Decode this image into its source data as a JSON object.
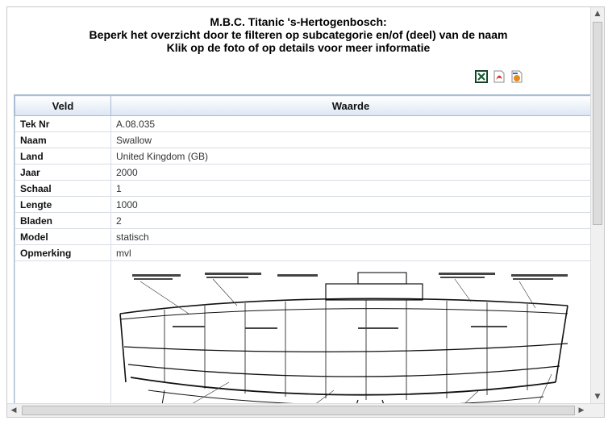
{
  "header": {
    "line1": "M.B.C. Titanic 's-Hertogenbosch:",
    "line2": "Beperk het overzicht door te filteren op subcategorie en/of (deel) van de naam",
    "line3": "Klik op de foto of op details voor meer informatie"
  },
  "export": {
    "excel_icon": "excel-icon",
    "pdf_icon": "pdf-icon",
    "xml_icon": "xml-icon"
  },
  "table": {
    "col_field": "Veld",
    "col_value": "Waarde",
    "rows": [
      {
        "field": "Tek Nr",
        "value": "A.08.035"
      },
      {
        "field": "Naam",
        "value": "Swallow"
      },
      {
        "field": "Land",
        "value": "United Kingdom (GB)"
      },
      {
        "field": "Jaar",
        "value": "2000"
      },
      {
        "field": "Schaal",
        "value": "1"
      },
      {
        "field": "Lengte",
        "value": "1000"
      },
      {
        "field": "Bladen",
        "value": "2"
      },
      {
        "field": "Model",
        "value": "statisch"
      },
      {
        "field": "Opmerking",
        "value": "mvl"
      }
    ]
  },
  "colors": {
    "header_border": "#a8bcd4",
    "cell_border": "#d7dde5"
  }
}
